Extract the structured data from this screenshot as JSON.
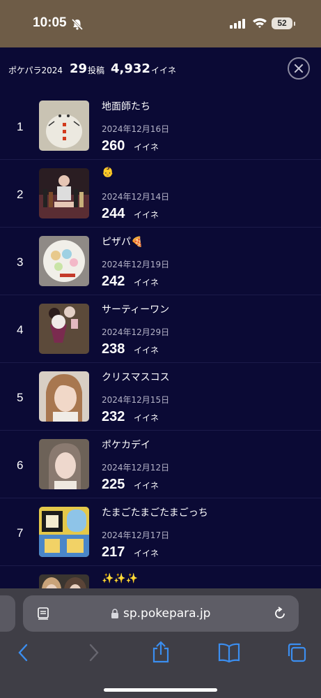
{
  "status_bar": {
    "time": "10:05",
    "battery": "52"
  },
  "summary": {
    "label": "ポケパラ2024",
    "posts": "29",
    "posts_unit": "投稿",
    "likes": "4,932",
    "likes_unit": "イイネ"
  },
  "ranking": [
    {
      "rank": "1",
      "title": "地面師たち",
      "date": "2024年12月16日",
      "likes": "260",
      "unit": "イイネ"
    },
    {
      "rank": "2",
      "title": "👶",
      "date": "2024年12月14日",
      "likes": "244",
      "unit": "イイネ"
    },
    {
      "rank": "3",
      "title": "ピザパ🍕",
      "date": "2024年12月19日",
      "likes": "242",
      "unit": "イイネ"
    },
    {
      "rank": "4",
      "title": "サーティーワン",
      "date": "2024年12月29日",
      "likes": "238",
      "unit": "イイネ"
    },
    {
      "rank": "5",
      "title": "クリスマスコス",
      "date": "2024年12月15日",
      "likes": "232",
      "unit": "イイネ"
    },
    {
      "rank": "6",
      "title": "ポケカデイ",
      "date": "2024年12月12日",
      "likes": "225",
      "unit": "イイネ"
    },
    {
      "rank": "7",
      "title": "たまごたまごたまごっち",
      "date": "2024年12月17日",
      "likes": "217",
      "unit": "イイネ"
    },
    {
      "rank": "",
      "title": "✨✨✨",
      "date": "",
      "likes": "",
      "unit": ""
    }
  ],
  "browser": {
    "url": "sp.pokepara.jp"
  },
  "icons": [
    "bell-off-icon",
    "signal-icon",
    "wifi-icon",
    "battery-icon",
    "close-icon",
    "reader-icon",
    "lock-icon",
    "reload-icon",
    "back-icon",
    "forward-icon",
    "share-icon",
    "bookmarks-icon",
    "tabs-icon"
  ]
}
